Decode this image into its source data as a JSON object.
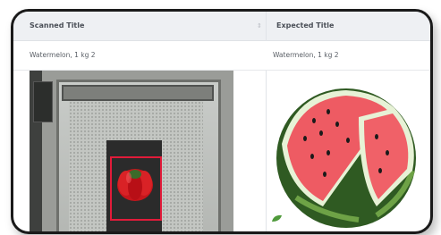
{
  "table": {
    "columns": [
      {
        "header": "Scanned Title"
      },
      {
        "header": "Expected Title"
      }
    ],
    "row": {
      "scanned_title": "Watermelon, 1 kg 2",
      "expected_title": "Watermelon, 1 kg 2"
    }
  },
  "icons": {
    "sort": "sort-icon"
  },
  "colors": {
    "bbox": "#e21b3a",
    "header_bg": "#eef0f3",
    "frame_border": "#1a1a1a"
  }
}
